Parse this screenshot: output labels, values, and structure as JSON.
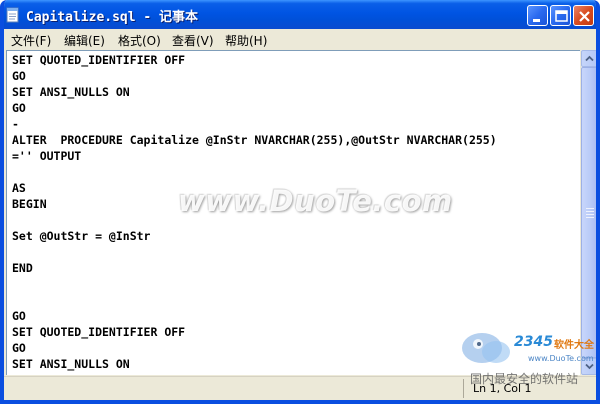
{
  "window": {
    "title": "Capitalize.sql - 记事本",
    "titlebar_color": "#0054e3",
    "buttons": [
      "minimize-icon",
      "maximize-icon",
      "close-icon"
    ]
  },
  "menu": {
    "items": [
      {
        "label": "文件(F)"
      },
      {
        "label": "编辑(E)"
      },
      {
        "label": "格式(O)"
      },
      {
        "label": "查看(V)"
      },
      {
        "label": "帮助(H)"
      }
    ]
  },
  "editor": {
    "lines": [
      "SET QUOTED_IDENTIFIER OFF",
      "GO",
      "SET ANSI_NULLS ON",
      "GO",
      "-",
      "ALTER  PROCEDURE Capitalize @InStr NVARCHAR(255),@OutStr NVARCHAR(255)",
      "='' OUTPUT",
      "",
      "AS",
      "BEGIN",
      "",
      "Set @OutStr = @InStr",
      "",
      "END",
      "",
      "",
      "GO",
      "SET QUOTED_IDENTIFIER OFF",
      "GO",
      "SET ANSI_NULLS ON"
    ]
  },
  "watermark": {
    "text": "www.DuoTe.com"
  },
  "status": {
    "position": "Ln 1, Col 1"
  },
  "badge": {
    "number": "2345",
    "brand": "软件大全",
    "url": "www.DuoTe.com",
    "slogan": "国内最安全的软件站"
  }
}
